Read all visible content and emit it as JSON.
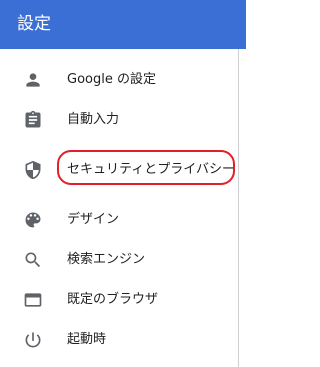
{
  "header": {
    "title": "設定",
    "bg_color": "#3b6fd6"
  },
  "nav": {
    "items": [
      {
        "label": "Google の設定",
        "icon": "person-icon"
      },
      {
        "label": "自動入力",
        "icon": "clipboard-icon"
      },
      {
        "label": "セキュリティとプライバシー",
        "icon": "shield-icon"
      },
      {
        "label": "デザイン",
        "icon": "palette-icon"
      },
      {
        "label": "検索エンジン",
        "icon": "search-icon"
      },
      {
        "label": "既定のブラウザ",
        "icon": "browser-icon"
      },
      {
        "label": "起動時",
        "icon": "power-icon"
      }
    ]
  },
  "annotation": {
    "color": "#e0202a"
  }
}
